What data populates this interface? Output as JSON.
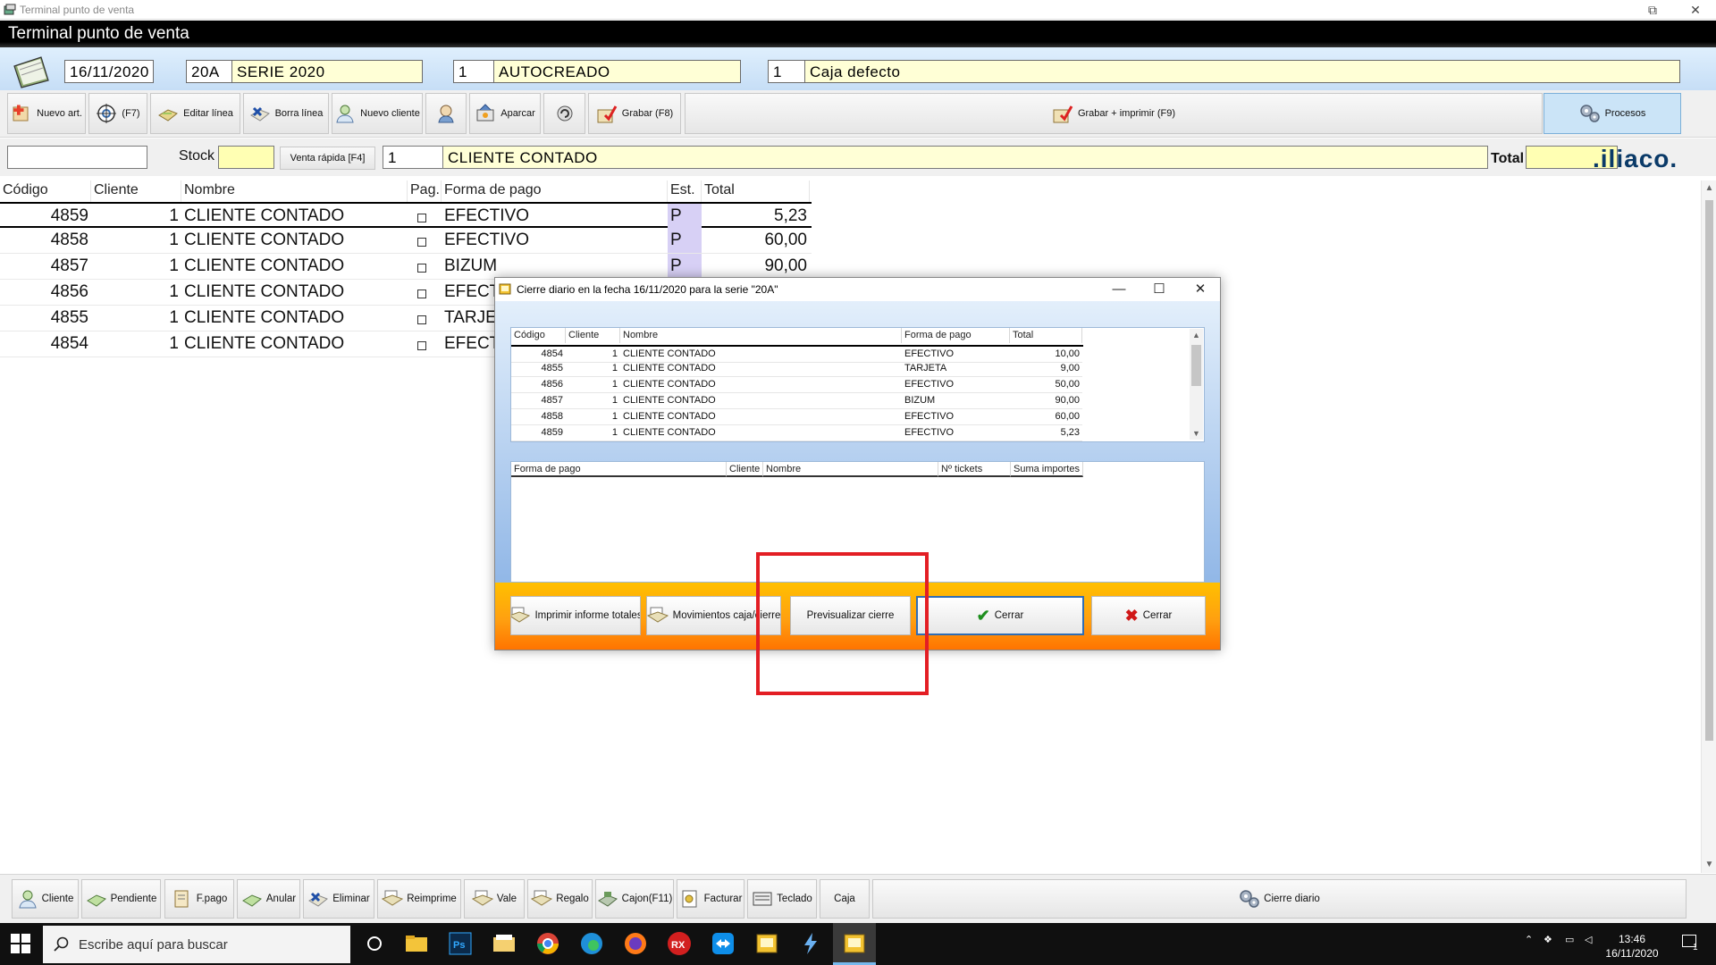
{
  "window": {
    "title": "Terminal punto de venta",
    "restore_glyph": "⧉",
    "close_glyph": "✕"
  },
  "app_header": {
    "title": "Terminal punto de venta"
  },
  "header_fields": {
    "date": "16/11/2020",
    "serie_code": "20A",
    "serie_name": "SERIE 2020",
    "user_code": "1",
    "user_name": "AUTOCREADO",
    "caja_code": "1",
    "caja_name": "Caja defecto"
  },
  "toolbar": {
    "nuevo_art": "Nuevo art.",
    "f7": "(F7)",
    "editar_linea": "Editar línea",
    "borra_linea": "Borra línea",
    "nuevo_cliente": "Nuevo cliente",
    "aparcar": "Aparcar",
    "grabar": "Grabar (F8)",
    "grabar_imprimir": "Grabar + imprimir (F9)",
    "procesos": "Procesos"
  },
  "search_row": {
    "article_value": "",
    "stock_label": "Stock",
    "stock_value": "",
    "venta_rapida": "Venta rápida [F4]",
    "client_code": "1",
    "client_name": "CLIENTE CONTADO",
    "total_label": "Total",
    "total_value": "",
    "logo": ".iliaco."
  },
  "tickets_table": {
    "columns": [
      "Código",
      "Cliente",
      "Nombre",
      "Pag.",
      "Forma de pago",
      "Est.",
      "Total"
    ],
    "rows": [
      {
        "codigo": "4859",
        "cliente": "1",
        "nombre": "CLIENTE CONTADO",
        "forma": "EFECTIVO",
        "est": "P",
        "total": "5,23"
      },
      {
        "codigo": "4858",
        "cliente": "1",
        "nombre": "CLIENTE CONTADO",
        "forma": "EFECTIVO",
        "est": "P",
        "total": "60,00"
      },
      {
        "codigo": "4857",
        "cliente": "1",
        "nombre": "CLIENTE CONTADO",
        "forma": "BIZUM",
        "est": "P",
        "total": "90,00"
      },
      {
        "codigo": "4856",
        "cliente": "1",
        "nombre": "CLIENTE CONTADO",
        "forma": "EFECT",
        "est": "",
        "total": ""
      },
      {
        "codigo": "4855",
        "cliente": "1",
        "nombre": "CLIENTE CONTADO",
        "forma": "TARJE",
        "est": "",
        "total": ""
      },
      {
        "codigo": "4854",
        "cliente": "1",
        "nombre": "CLIENTE CONTADO",
        "forma": "EFECT",
        "est": "",
        "total": ""
      }
    ]
  },
  "dialog": {
    "title": "Cierre diario en la fecha 16/11/2020 para la serie \"20A\"",
    "minimize_glyph": "—",
    "maximize_glyph": "☐",
    "close_glyph": "✕",
    "detail_columns": [
      "Código",
      "Cliente",
      "Nombre",
      "Forma de pago",
      "Total"
    ],
    "detail_rows": [
      {
        "codigo": "4854",
        "cliente": "1",
        "nombre": "CLIENTE CONTADO",
        "forma": "EFECTIVO",
        "total": "10,00"
      },
      {
        "codigo": "4855",
        "cliente": "1",
        "nombre": "CLIENTE CONTADO",
        "forma": "TARJETA",
        "total": "9,00"
      },
      {
        "codigo": "4856",
        "cliente": "1",
        "nombre": "CLIENTE CONTADO",
        "forma": "EFECTIVO",
        "total": "50,00"
      },
      {
        "codigo": "4857",
        "cliente": "1",
        "nombre": "CLIENTE CONTADO",
        "forma": "BIZUM",
        "total": "90,00"
      },
      {
        "codigo": "4858",
        "cliente": "1",
        "nombre": "CLIENTE CONTADO",
        "forma": "EFECTIVO",
        "total": "60,00"
      },
      {
        "codigo": "4859",
        "cliente": "1",
        "nombre": "CLIENTE CONTADO",
        "forma": "EFECTIVO",
        "total": "5,23"
      }
    ],
    "summary_columns": [
      "Forma de pago",
      "Cliente",
      "Nombre",
      "Nº tickets",
      "Suma importes"
    ],
    "buttons": {
      "imprimir": "Imprimir informe totales",
      "movimientos": "Movimientos caja/cierre",
      "previsualizar": "Previsualizar cierre",
      "cerrar_ok": "Cerrar",
      "cerrar_cancel": "Cerrar"
    }
  },
  "bottom_toolbar": {
    "cliente": "Cliente",
    "pendiente": "Pendiente",
    "fpago": "F.pago",
    "anular": "Anular",
    "eliminar": "Eliminar",
    "reimprime": "Reimprime",
    "vale": "Vale",
    "regalo": "Regalo",
    "cajon": "Cajon(F11)",
    "facturar": "Facturar",
    "teclado": "Teclado",
    "caja": "Caja",
    "cierre_diario": "Cierre diario"
  },
  "taskbar": {
    "search_placeholder": "Escribe aquí para buscar",
    "time": "13:46",
    "date": "16/11/2020",
    "notif_count": "1"
  },
  "colors": {
    "accent": "#2f6db5",
    "highlight": "#e31e24",
    "field_yellow": "#ffffd6",
    "dialog_footer": "#ffa010"
  }
}
